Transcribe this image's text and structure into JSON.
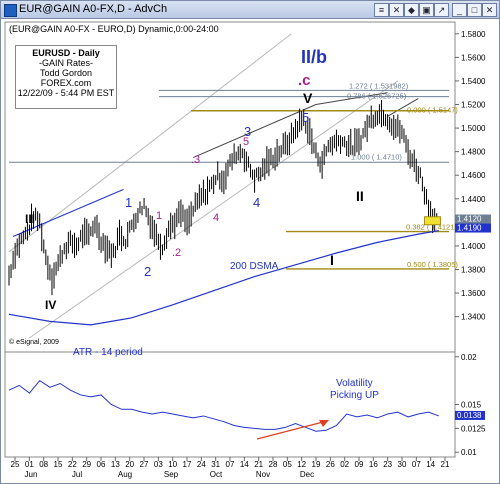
{
  "window": {
    "title": "EUR@GAIN A0-FX,D - AdvCh",
    "buttons": [
      "≡",
      "✕",
      "◆",
      "▣",
      "↗",
      "_",
      "□",
      "✕"
    ]
  },
  "chart_header": "(EUR@GAIN A0-FX - EURO,D) Dynamic,0:00-24:00",
  "info_box": [
    "EURUSD - Daily",
    "-GAIN Rates-",
    "Todd Gordon",
    "FOREX.com",
    "12/22/09 - 5:44 PM EST"
  ],
  "copyright": "© eSignal, 2009",
  "colors": {
    "price": "#000000",
    "ma": "#2233cc",
    "wave_blue": "#2233bb",
    "wave_purple": "#a0208f",
    "fib_gray": "#6e7f94",
    "fib_gold": "#a08a14",
    "atr": "#2233cc",
    "arrow": "#e04020",
    "highlight": "#f0e030"
  },
  "chart_data": [
    {
      "type": "line",
      "title": "",
      "ylim": [
        1.31,
        1.59
      ],
      "y_ticks": [
        "1.5800",
        "1.5600",
        "1.5400",
        "1.5200",
        "1.5000",
        "1.4800",
        "1.4600",
        "1.4400",
        "1.4200",
        "1.4000",
        "1.3800",
        "1.3600",
        "1.3400"
      ],
      "y_tick_values": [
        1.58,
        1.56,
        1.54,
        1.52,
        1.5,
        1.48,
        1.46,
        1.44,
        1.42,
        1.4,
        1.38,
        1.36,
        1.34
      ],
      "last_value_label": "1.4190",
      "last_value_label_bg": "1.4120",
      "series": [
        {
          "x": [
            0,
            3,
            6,
            9,
            12,
            15,
            18,
            21,
            24,
            27,
            30,
            33,
            36,
            39,
            42,
            45,
            48,
            51,
            54,
            57,
            60,
            63,
            66,
            69,
            72,
            75,
            78,
            81,
            84,
            87,
            90,
            93,
            96,
            99,
            102,
            105,
            108,
            111,
            114,
            117,
            120,
            123,
            126,
            129,
            132,
            135,
            138,
            141,
            144,
            147,
            150,
            153,
            156,
            159,
            162,
            165,
            168,
            171,
            174,
            177,
            180,
            183,
            186,
            189,
            192,
            195,
            198,
            201,
            204,
            207,
            210
          ],
          "values": [
            1.375,
            1.395,
            1.405,
            1.412,
            1.425,
            1.42,
            1.39,
            1.373,
            1.385,
            1.398,
            1.403,
            1.4,
            1.41,
            1.408,
            1.42,
            1.405,
            1.398,
            1.393,
            1.41,
            1.405,
            1.418,
            1.428,
            1.435,
            1.42,
            1.408,
            1.4,
            1.415,
            1.42,
            1.428,
            1.418,
            1.43,
            1.44,
            1.445,
            1.452,
            1.46,
            1.456,
            1.47,
            1.478,
            1.48,
            1.468,
            1.458,
            1.462,
            1.47,
            1.475,
            1.48,
            1.485,
            1.492,
            1.502,
            1.508,
            1.495,
            1.478,
            1.47,
            1.485,
            1.488,
            1.49,
            1.486,
            1.484,
            1.488,
            1.498,
            1.508,
            1.512,
            1.512,
            1.506,
            1.5,
            1.497,
            1.48,
            1.47,
            1.46,
            1.44,
            1.425,
            1.419
          ]
        },
        {
          "name": "200 DSMA",
          "x": [
            0,
            20,
            40,
            60,
            80,
            100,
            120,
            140,
            160,
            180,
            200,
            210
          ],
          "values": [
            1.342,
            1.336,
            1.333,
            1.339,
            1.35,
            1.362,
            1.374,
            1.384,
            1.394,
            1.403,
            1.41,
            1.413
          ]
        }
      ],
      "fib_levels": [
        {
          "label": "1.272 ( 1.531982)",
          "value": 1.532
        },
        {
          "label": "0.786 ( 1.526725)",
          "value": 1.5267
        },
        {
          "label": "0.000 ( 1.5147)",
          "value": 1.5147
        },
        {
          "label": "1.000 ( 1.4710)",
          "value": 1.471
        },
        {
          "label": "0.382 ( 1.41217)",
          "value": 1.4122
        },
        {
          "label": "0.500 ( 1.3805)",
          "value": 1.3805
        }
      ],
      "annotations": [
        {
          "text": "II/b",
          "size": "large"
        },
        {
          "text": ".c"
        },
        {
          "text": "V"
        },
        {
          "text": "II"
        },
        {
          "text": "I"
        },
        {
          "text": "III"
        },
        {
          "text": "IV"
        },
        {
          "text": "1"
        },
        {
          "text": "2"
        },
        {
          "text": "3"
        },
        {
          "text": "4"
        },
        {
          "text": "5"
        },
        {
          "text": "1"
        },
        {
          "text": ".2"
        },
        {
          "text": ".3"
        },
        {
          "text": "4"
        },
        {
          "text": "5"
        },
        {
          "text": "200 DSMA"
        }
      ]
    },
    {
      "type": "line",
      "title": "ATR - 14 period",
      "ylim": [
        0.0095,
        0.0205
      ],
      "y_ticks": [
        "0.02",
        "0.015",
        "0.0125",
        "0.01"
      ],
      "y_tick_values": [
        0.02,
        0.015,
        0.0125,
        0.01
      ],
      "last_value_label": "0.0138",
      "series": [
        {
          "x": [
            0,
            5,
            10,
            15,
            20,
            25,
            30,
            35,
            40,
            45,
            50,
            55,
            60,
            65,
            70,
            75,
            80,
            85,
            90,
            95,
            100,
            105,
            110,
            115,
            120,
            125,
            130,
            135,
            140,
            145,
            150,
            155,
            160,
            165,
            170,
            175,
            180,
            185,
            190,
            195,
            200,
            205,
            210
          ],
          "values": [
            0.0165,
            0.017,
            0.0162,
            0.0175,
            0.0168,
            0.0172,
            0.0165,
            0.016,
            0.0158,
            0.016,
            0.015,
            0.0145,
            0.0145,
            0.0142,
            0.014,
            0.0142,
            0.014,
            0.0138,
            0.0136,
            0.0138,
            0.0135,
            0.0132,
            0.0128,
            0.0126,
            0.0125,
            0.0124,
            0.0124,
            0.0126,
            0.013,
            0.0126,
            0.0122,
            0.0123,
            0.0128,
            0.014,
            0.0137,
            0.0139,
            0.0136,
            0.014,
            0.0142,
            0.0137,
            0.014,
            0.0142,
            0.0138
          ]
        }
      ],
      "annotations": [
        {
          "text": "Volatility"
        },
        {
          "text": "Picking UP"
        }
      ]
    }
  ],
  "x_axis": {
    "day_labels": [
      "25",
      "01",
      "08",
      "15",
      "22",
      "29",
      "06",
      "13",
      "20",
      "27",
      "03",
      "10",
      "17",
      "24",
      "31",
      "07",
      "14",
      "21",
      "28",
      "05",
      "12",
      "19",
      "26",
      "02",
      "09",
      "16",
      "23",
      "30",
      "07",
      "14",
      "21"
    ],
    "month_labels": [
      "Jun",
      "Jul",
      "Aug",
      "Sep",
      "Oct",
      "Nov",
      "Dec"
    ]
  }
}
